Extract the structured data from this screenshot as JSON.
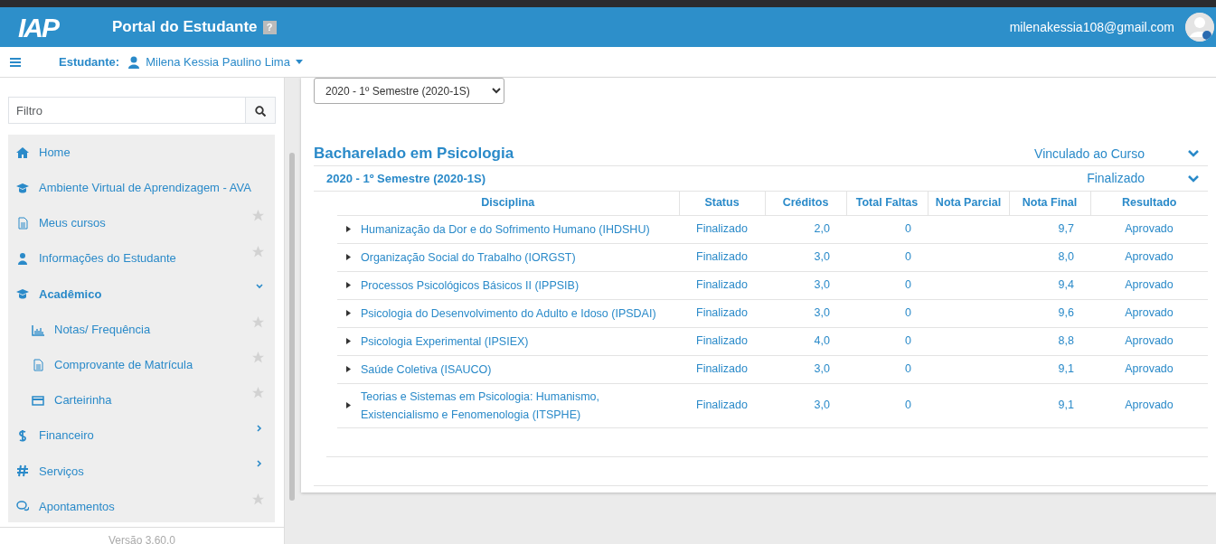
{
  "header": {
    "logo": "IAP",
    "title": "Portal do Estudante",
    "help": "?",
    "email": "milenakessia108@gmail.com"
  },
  "subbar": {
    "label": "Estudante:",
    "student": "Milena Kessia Paulino Lima"
  },
  "sidebar": {
    "filter_placeholder": "Filtro",
    "version": "Versão 3.60.0",
    "items": [
      {
        "kind": "link",
        "label": "Home",
        "favoritable": false
      },
      {
        "kind": "link",
        "label": "Ambiente Virtual de Aprendizagem - AVA",
        "favoritable": false
      },
      {
        "kind": "link",
        "label": "Meus cursos",
        "favoritable": true
      },
      {
        "kind": "link",
        "label": "Informações do Estudante",
        "favoritable": true
      },
      {
        "kind": "group",
        "label": "Acadêmico",
        "expanded": true,
        "children": [
          {
            "label": "Notas/ Frequência",
            "favoritable": true
          },
          {
            "label": "Comprovante de Matrícula",
            "favoritable": true
          },
          {
            "label": "Carteirinha",
            "favoritable": true
          }
        ]
      },
      {
        "kind": "group",
        "label": "Financeiro",
        "expanded": false
      },
      {
        "kind": "group",
        "label": "Serviços",
        "expanded": false
      },
      {
        "kind": "link",
        "label": "Apontamentos",
        "favoritable": true
      }
    ]
  },
  "period_select": "2020 - 1º Semestre (2020-1S)",
  "course": {
    "name": "Bacharelado em Psicologia",
    "status": "Vinculado ao Curso",
    "expanded": true,
    "semester": {
      "name": "2020 - 1º Semestre (2020-1S)",
      "status": "Finalizado",
      "expanded": true,
      "columns": [
        "Disciplina",
        "Status",
        "Créditos",
        "Total Faltas",
        "Nota Parcial",
        "Nota Final",
        "Resultado"
      ],
      "rows": [
        {
          "disciplina": "Humanização da Dor e do Sofrimento Humano (IHDSHU)",
          "status": "Finalizado",
          "creditos": "2,0",
          "faltas": "0",
          "nota_final": "9,7",
          "resultado": "Aprovado"
        },
        {
          "disciplina": "Organização Social do Trabalho (IORGST)",
          "status": "Finalizado",
          "creditos": "3,0",
          "faltas": "0",
          "nota_final": "8,0",
          "resultado": "Aprovado"
        },
        {
          "disciplina": "Processos Psicológicos Básicos II (IPPSIB)",
          "status": "Finalizado",
          "creditos": "3,0",
          "faltas": "0",
          "nota_final": "9,4",
          "resultado": "Aprovado"
        },
        {
          "disciplina": "Psicologia do Desenvolvimento do Adulto e Idoso (IPSDAI)",
          "status": "Finalizado",
          "creditos": "3,0",
          "faltas": "0",
          "nota_final": "9,6",
          "resultado": "Aprovado"
        },
        {
          "disciplina": "Psicologia Experimental (IPSIEX)",
          "status": "Finalizado",
          "creditos": "4,0",
          "faltas": "0",
          "nota_final": "8,8",
          "resultado": "Aprovado"
        },
        {
          "disciplina": "Saúde Coletiva (ISAUCO)",
          "status": "Finalizado",
          "creditos": "3,0",
          "faltas": "0",
          "nota_final": "9,1",
          "resultado": "Aprovado"
        },
        {
          "disciplina": "Teorias e Sistemas em Psicologia: Humanismo, Existencialismo e Fenomenologia (ITSPHE)",
          "status": "Finalizado",
          "creditos": "3,0",
          "faltas": "0",
          "nota_final": "9,1",
          "resultado": "Aprovado"
        }
      ]
    }
  }
}
